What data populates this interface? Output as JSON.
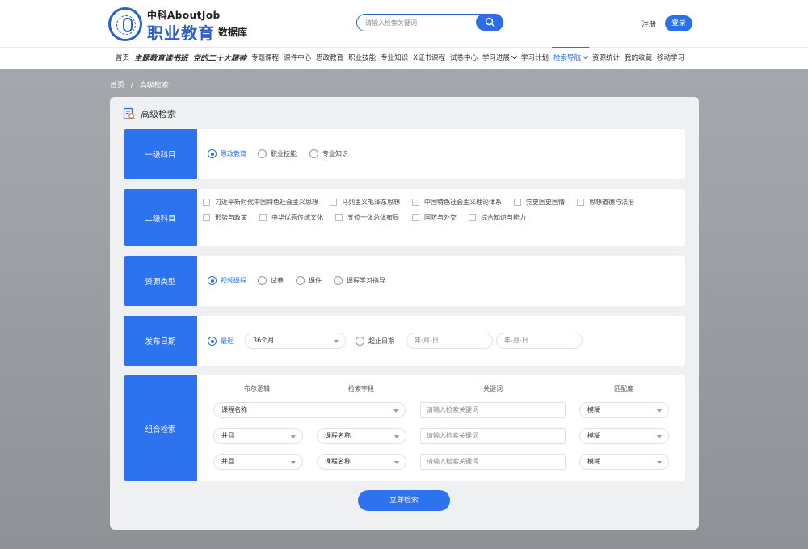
{
  "logo": {
    "line1": "中科AboutJob",
    "line2": "职业教育",
    "line3": "数据库"
  },
  "search": {
    "placeholder": "请输入检索关键词"
  },
  "header": {
    "register": "注册",
    "login": "登录"
  },
  "nav": {
    "items": [
      "首页",
      "主题教育读书班",
      "党的二十大精神",
      "专题课程",
      "课件中心",
      "思政教育",
      "职业技能",
      "专业知识",
      "X证书课程",
      "试卷中心",
      "学习进展",
      "学习计划",
      "检索导航",
      "资源统计",
      "我的收藏",
      "移动学习"
    ],
    "active": "检索导航"
  },
  "breadcrumb": {
    "home": "首页",
    "sep": "/",
    "current": "高级检索"
  },
  "page_title": "高级检索",
  "level1": {
    "label": "一级科目",
    "options": [
      "思政教育",
      "职业技能",
      "专业知识"
    ],
    "selected": "思政教育"
  },
  "level2": {
    "label": "二级科目",
    "options": [
      "习近平新时代中国特色社会主义思想",
      "马列主义毛泽东思想",
      "中国特色社会主义理论体系",
      "党史国史国情",
      "思想道德与法治",
      "形势与政策",
      "中华优秀传统文化",
      "五位一体总体布局",
      "国防与外交",
      "综合知识与能力"
    ]
  },
  "resource_type": {
    "label": "资源类型",
    "options": [
      "视频课程",
      "试卷",
      "课件",
      "课程学习指导"
    ],
    "selected": "视频课程"
  },
  "publish_date": {
    "label": "发布日期",
    "recent_label": "最近",
    "recent_value": "36个月",
    "range_label": "起止日期",
    "start_placeholder": "年-月-日",
    "end_placeholder": "年-月-日"
  },
  "combo": {
    "label": "组合检索",
    "headers": {
      "bool": "布尔逻辑",
      "field": "检索字段",
      "keyword": "关键词",
      "match": "匹配度"
    },
    "rows": [
      {
        "field": "课程名称",
        "keyword_placeholder": "请输入检索关键词",
        "match": "模糊"
      },
      {
        "bool": "并且",
        "field": "课程名称",
        "keyword_placeholder": "请输入检索关键词",
        "match": "模糊"
      },
      {
        "bool": "并且",
        "field": "课程名称",
        "keyword_placeholder": "请输入检索关键词",
        "match": "模糊"
      }
    ]
  },
  "submit_label": "立即检索",
  "colors": {
    "primary": "#2d72ef",
    "background": "#9ea2a6"
  }
}
